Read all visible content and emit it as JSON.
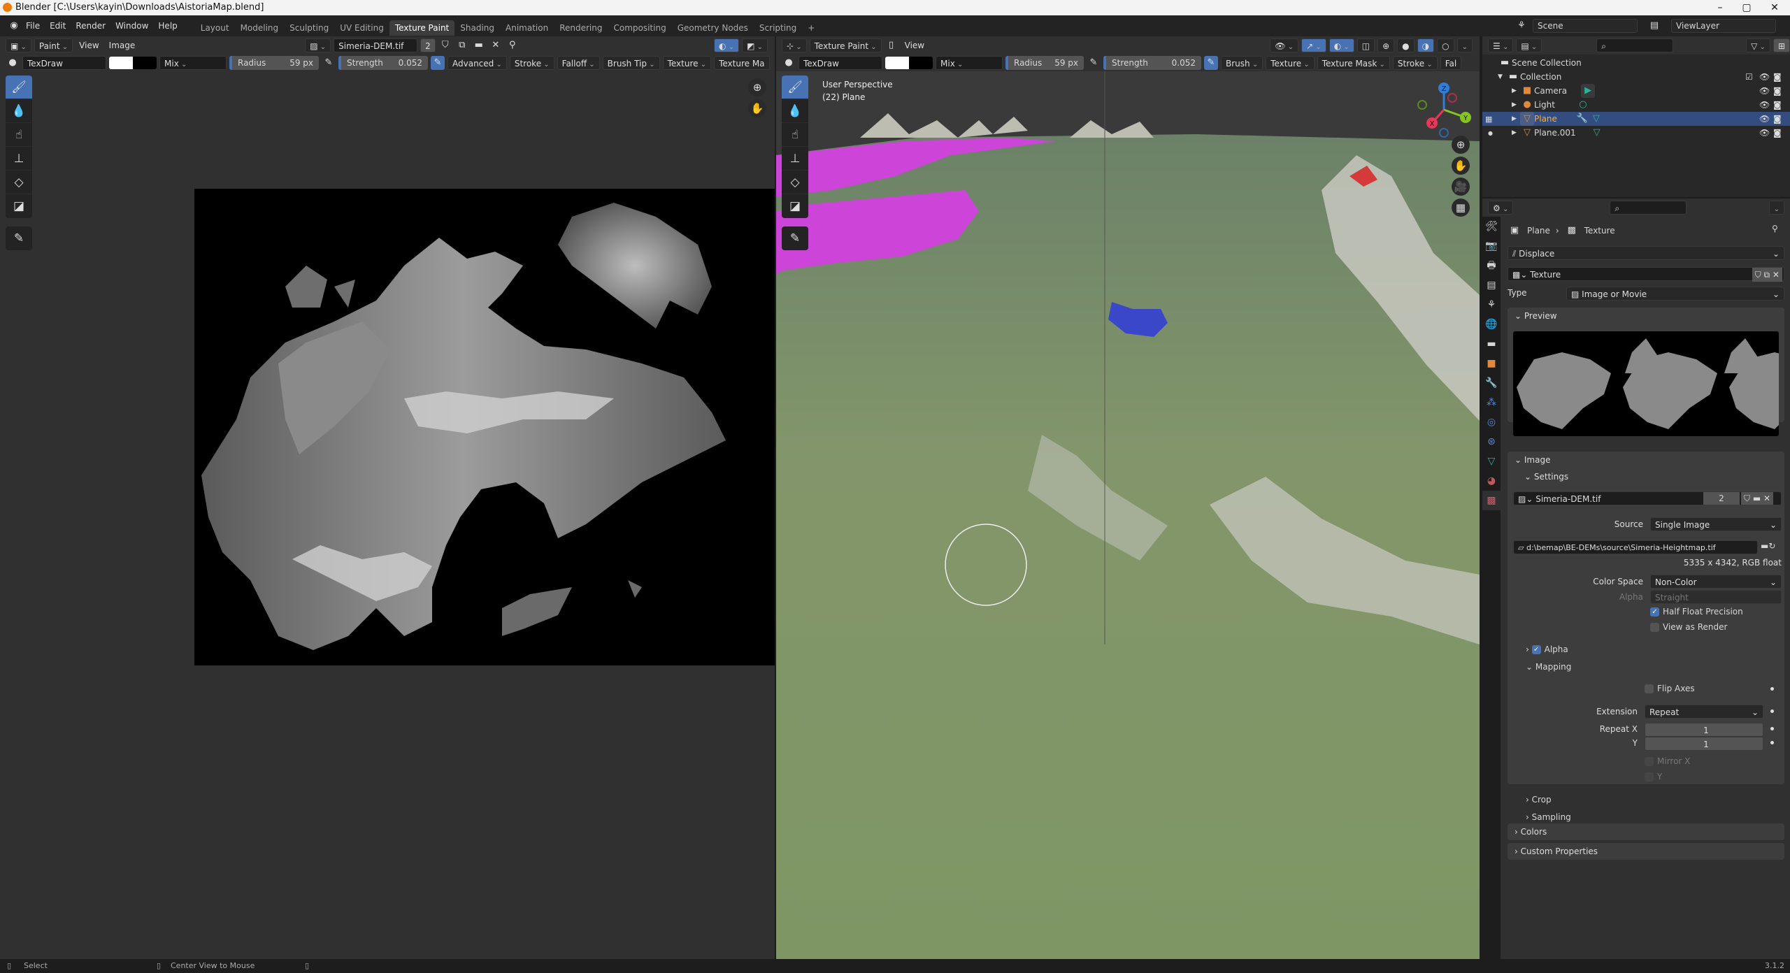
{
  "window": {
    "title": "Blender [C:\\Users\\kayin\\Downloads\\AistoriaMap.blend]",
    "minimize": "–",
    "maximize": "▢",
    "close": "✕"
  },
  "menubar": {
    "menus": [
      "File",
      "Edit",
      "Render",
      "Window",
      "Help"
    ],
    "workspaces": [
      "Layout",
      "Modeling",
      "Sculpting",
      "UV Editing",
      "Texture Paint",
      "Shading",
      "Animation",
      "Rendering",
      "Compositing",
      "Geometry Nodes",
      "Scripting"
    ],
    "active_workspace": "Texture Paint",
    "add_workspace": "+",
    "scene": "Scene",
    "view_layer": "ViewLayer"
  },
  "image_editor": {
    "mode": "Paint",
    "menus": [
      "View",
      "Image"
    ],
    "image_name": "Simeria-DEM.tif",
    "users": "2",
    "brush": "TexDraw",
    "blend": "Mix",
    "radius_label": "Radius",
    "radius_value": "59 px",
    "strength_label": "Strength",
    "strength_value": "0.052",
    "popovers": [
      "Advanced",
      "Stroke",
      "Falloff",
      "Brush Tip",
      "Texture",
      "Texture Ma"
    ]
  },
  "viewport": {
    "mode": "Texture Paint",
    "menus": [
      "View"
    ],
    "brush": "TexDraw",
    "blend": "Mix",
    "radius_label": "Radius",
    "radius_value": "59 px",
    "strength_label": "Strength",
    "strength_value": "0.052",
    "popovers": [
      "Brush",
      "Texture",
      "Texture Mask",
      "Stroke",
      "Fal"
    ],
    "overlay_line1": "User Perspective",
    "overlay_line2": "(22) Plane",
    "gizmo": {
      "x": "X",
      "y": "Y",
      "z": "Z"
    }
  },
  "tools": [
    "brush-draw",
    "soften",
    "smear",
    "clone",
    "fill",
    "mask",
    "annotate"
  ],
  "outliner": {
    "scene_collection": "Scene Collection",
    "collection": "Collection",
    "items": [
      {
        "name": "Camera",
        "type": "camera"
      },
      {
        "name": "Light",
        "type": "light"
      },
      {
        "name": "Plane",
        "type": "mesh",
        "selected": true
      },
      {
        "name": "Plane.001",
        "type": "mesh"
      }
    ]
  },
  "properties": {
    "breadcrumb": [
      "Plane",
      "Texture"
    ],
    "modifier": "Displace",
    "texture_name": "Texture",
    "type_label": "Type",
    "type_value": "Image or Movie",
    "preview_label": "Preview",
    "image_label": "Image",
    "settings_label": "Settings",
    "image_name": "Simeria-DEM.tif",
    "image_users": "2",
    "source_label": "Source",
    "source_value": "Single Image",
    "filepath": "d:\\bemap\\BE-DEMs\\source\\Simeria-Heightmap.tif",
    "image_info": "5335 x 4342,  RGB float",
    "color_space_label": "Color Space",
    "color_space_value": "Non-Color",
    "alpha_label": "Alpha",
    "alpha_value": "Straight",
    "half_float": {
      "label": "Half Float Precision",
      "checked": true
    },
    "view_as_render": {
      "label": "View as Render",
      "checked": false
    },
    "alpha_panel": {
      "label": "Alpha",
      "checked": true
    },
    "mapping_label": "Mapping",
    "flip_axes": {
      "label": "Flip Axes",
      "checked": false
    },
    "extension_label": "Extension",
    "extension_value": "Repeat",
    "repeat_x_label": "Repeat X",
    "repeat_x": "1",
    "repeat_y_label": "Y",
    "repeat_y": "1",
    "mirror_x": {
      "label": "Mirror X",
      "checked": false
    },
    "mirror_y": {
      "label": "Y",
      "checked": false
    },
    "crop_label": "Crop",
    "sampling_label": "Sampling",
    "colors_label": "Colors",
    "custom_props_label": "Custom Properties"
  },
  "statusbar": {
    "select": "Select",
    "center_view": "Center View to Mouse",
    "version": "3.1.2"
  },
  "colors": {
    "accent": "#4772b3",
    "selected_row": "#334d80",
    "object_orange": "#e0893a",
    "data_green": "#2bb39a"
  }
}
